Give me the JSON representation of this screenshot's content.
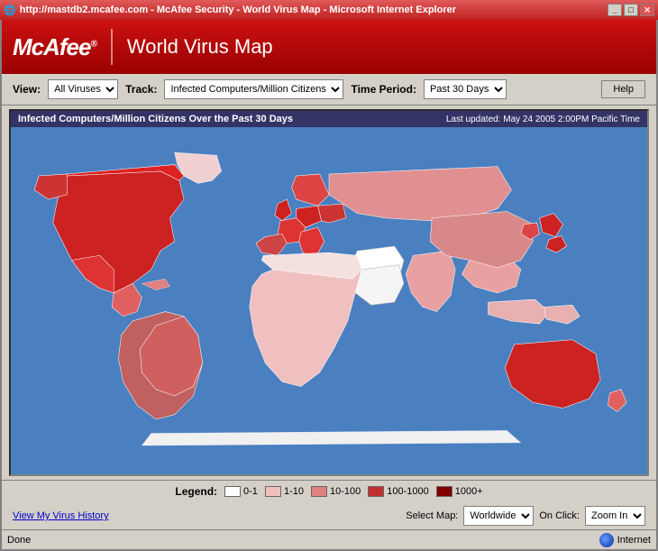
{
  "window": {
    "title": "http://mastdb2.mcafee.com - McAfee Security - World Virus Map - Microsoft Internet Explorer",
    "title_bar_icon": "ie-icon"
  },
  "header": {
    "logo": "McAfee",
    "logo_trademark": "®",
    "title": "World Virus Map"
  },
  "controls": {
    "view_label": "View:",
    "view_value": "All Viruses",
    "track_label": "Track:",
    "track_value": "Infected Computers/Million Citizens",
    "time_period_label": "Time Period:",
    "time_period_value": "Past 30 Days",
    "help_label": "Help"
  },
  "map": {
    "header_text": "Infected Computers/Million Citizens Over the Past 30 Days",
    "last_updated": "Last updated: May 24 2005 2:00PM Pacific Time"
  },
  "legend": {
    "label": "Legend:",
    "items": [
      {
        "range": "0-1",
        "color": "#ffffff"
      },
      {
        "range": "1-10",
        "color": "#f0c0c0"
      },
      {
        "range": "10-100",
        "color": "#e08080"
      },
      {
        "range": "100-1000",
        "color": "#c03030"
      },
      {
        "range": "1000+",
        "color": "#800000"
      }
    ]
  },
  "bottom": {
    "view_history_label": "View My Virus History",
    "select_map_label": "Select Map:",
    "select_map_value": "Worldwide",
    "on_click_label": "On Click:",
    "on_click_value": "Zoom In"
  },
  "status_bar": {
    "done_label": "Done",
    "internet_label": "Internet"
  }
}
